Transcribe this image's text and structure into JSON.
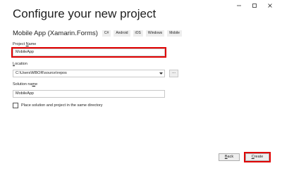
{
  "window": {
    "controls": {
      "minimize": "minimize-icon",
      "maximize": "maximize-icon",
      "close": "close-icon"
    }
  },
  "page": {
    "title": "Configure your new project"
  },
  "template": {
    "name": "Mobile App (Xamarin.Forms)",
    "tags": [
      "C#",
      "Android",
      "iOS",
      "Windows",
      "Mobile"
    ]
  },
  "project_name": {
    "label_accel": "N",
    "label_pre": "Project ",
    "label_post": "ame",
    "value": "MobileApp"
  },
  "location": {
    "label_accel": "L",
    "label_rest": "ocation",
    "value": "C:\\Users\\MBOR\\source\\repos",
    "browse_label": "..."
  },
  "solution_name": {
    "label_pre": "Solution na",
    "label_accel": "m",
    "label_post": "e",
    "value": "MobileApp"
  },
  "same_directory": {
    "label": "Place solution and project in the same directory",
    "checked": false
  },
  "buttons": {
    "back_accel": "B",
    "back_rest": "ack",
    "create_accel": "C",
    "create_rest": "reate"
  },
  "colors": {
    "highlight": "#e00000",
    "text": "#1e1e1e",
    "border": "#c8c8c8",
    "tag_bg": "#eeeeee"
  }
}
